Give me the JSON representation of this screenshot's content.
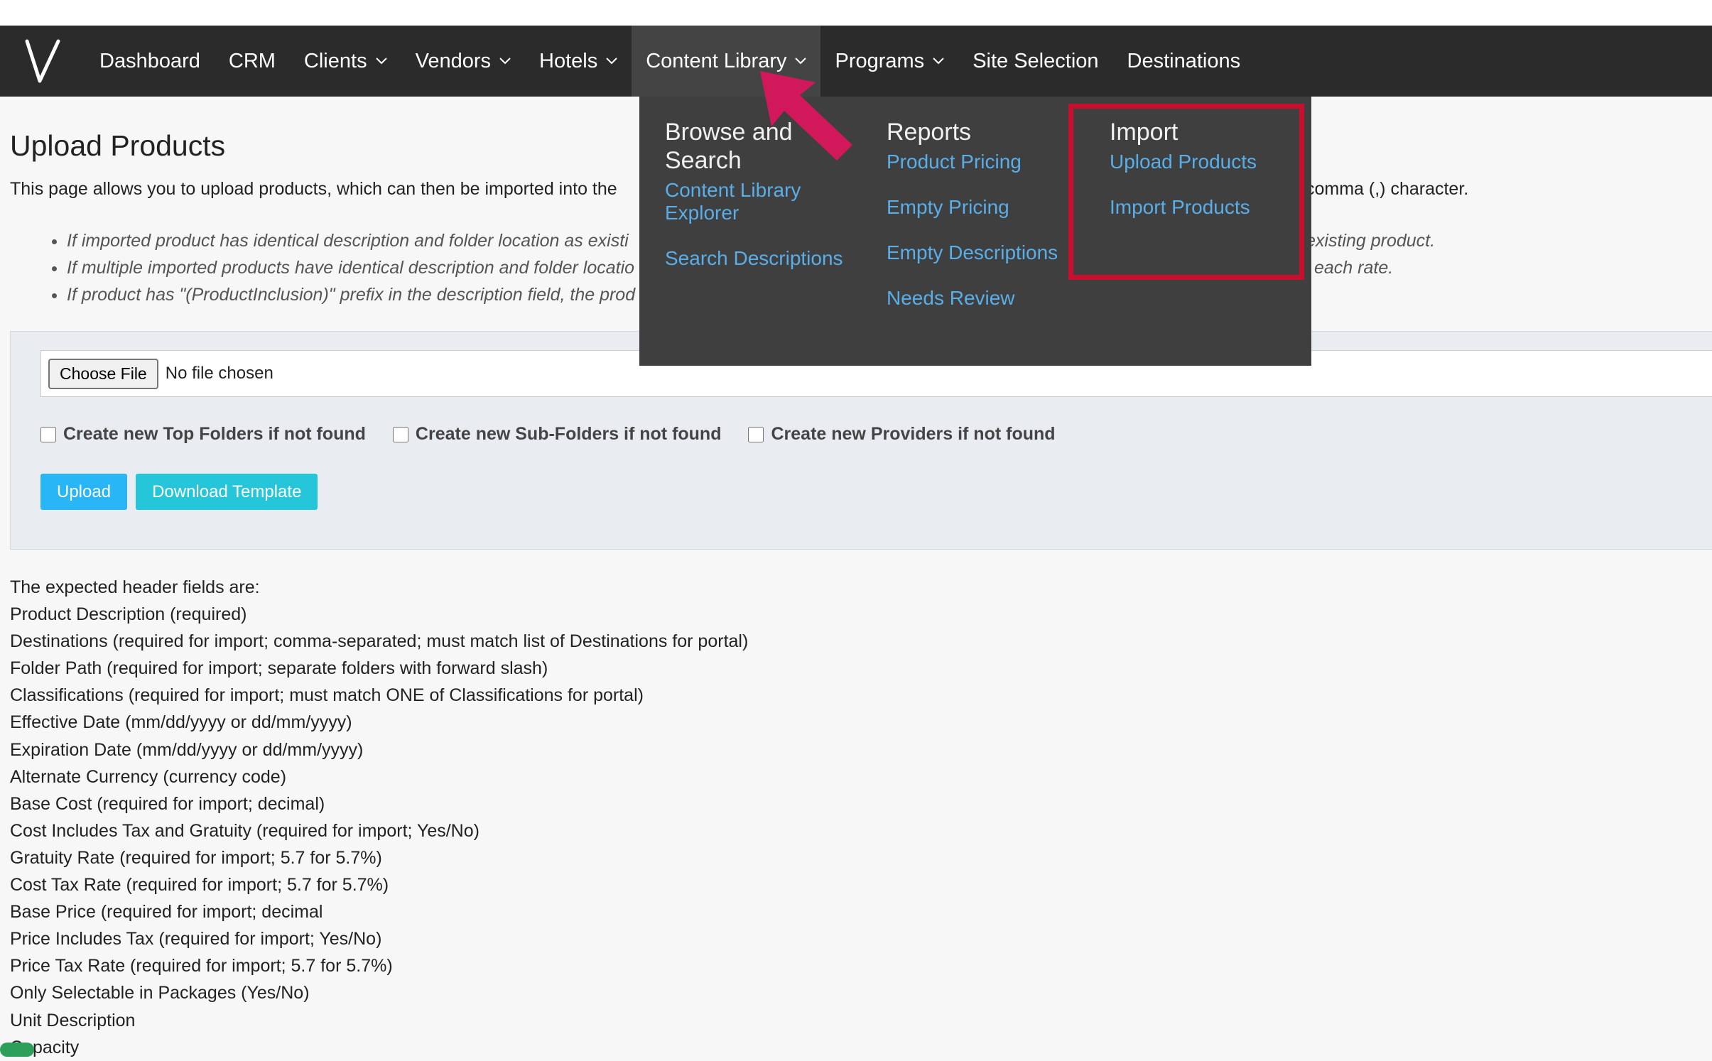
{
  "nav": {
    "items": [
      {
        "label": "Dashboard",
        "dropdown": false
      },
      {
        "label": "CRM",
        "dropdown": false
      },
      {
        "label": "Clients",
        "dropdown": true
      },
      {
        "label": "Vendors",
        "dropdown": true
      },
      {
        "label": "Hotels",
        "dropdown": true
      },
      {
        "label": "Content Library",
        "dropdown": true,
        "active": true
      },
      {
        "label": "Programs",
        "dropdown": true
      },
      {
        "label": "Site Selection",
        "dropdown": false
      },
      {
        "label": "Destinations",
        "dropdown": false
      }
    ]
  },
  "dropdown": {
    "browse": {
      "heading": "Browse and Search",
      "links": [
        "Content Library Explorer",
        "Search Descriptions"
      ]
    },
    "reports": {
      "heading": "Reports",
      "links": [
        "Product Pricing",
        "Empty Pricing",
        "Empty Descriptions",
        "Needs Review"
      ]
    },
    "import": {
      "heading": "Import",
      "links": [
        "Upload Products",
        "Import Products"
      ]
    }
  },
  "page": {
    "title": "Upload Products",
    "intro": "This page allows you to upload products, which can then be imported into the",
    "intro_tail": "comma (,) character.",
    "notes": [
      "If imported product has identical description and folder location as existi",
      "If multiple imported products have identical description and folder locatio",
      "If product has \"(ProductInclusion)\" prefix in the description field, the prod"
    ],
    "note_tails": [
      "existing product.",
      "each rate."
    ]
  },
  "upload": {
    "choose_file": "Choose File",
    "no_file": "No file chosen",
    "checkboxes": [
      "Create new Top Folders if not found",
      "Create new Sub-Folders if not found",
      "Create new Providers if not found"
    ],
    "upload_button": "Upload",
    "template_button": "Download Template"
  },
  "header_fields": {
    "intro": "The expected header fields are:",
    "fields": [
      "Product Description (required)",
      "Destinations (required for import; comma-separated; must match list of Destinations for portal)",
      "Folder Path (required for import; separate folders with forward slash)",
      "Classifications (required for import; must match ONE of Classifications for portal)",
      "Effective Date (mm/dd/yyyy or dd/mm/yyyy)",
      "Expiration Date (mm/dd/yyyy or dd/mm/yyyy)",
      "Alternate Currency (currency code)",
      "Base Cost (required for import; decimal)",
      "Cost Includes Tax and Gratuity (required for import; Yes/No)",
      "Gratuity Rate (required for import; 5.7 for 5.7%)",
      "Cost Tax Rate (required for import; 5.7 for 5.7%)",
      "Base Price (required for import; decimal",
      "Price Includes Tax (required for import; Yes/No)",
      "Price Tax Rate (required for import; 5.7 for 5.7%)",
      "Only Selectable in Packages (Yes/No)",
      "Unit Description",
      "Capacity"
    ]
  },
  "colors": {
    "navbar": "#2b2b2b",
    "dropdown": "#3f3f3f",
    "link": "#5aaee8",
    "highlight": "#c8102e",
    "arrow": "#d0185a",
    "upload": "#29b6f6",
    "template": "#26c6da"
  }
}
